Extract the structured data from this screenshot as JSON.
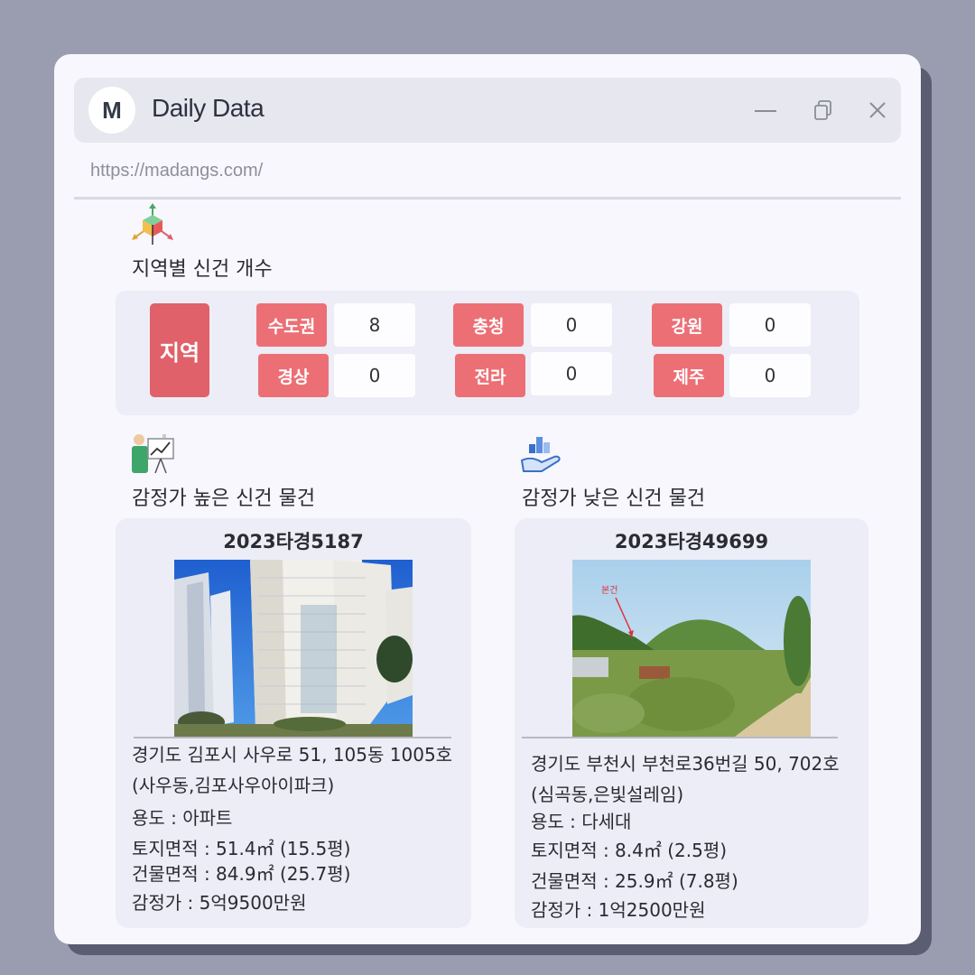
{
  "window": {
    "avatar_letter": "M",
    "title": "Daily Data",
    "url": "https://madangs.com/",
    "controls": [
      "minimize-icon",
      "copy-icon",
      "close-icon"
    ]
  },
  "region_section": {
    "title": "지역별 신건 개수",
    "icon": "cube-axes-icon",
    "main_label": "지역",
    "regions": [
      {
        "name": "수도권",
        "count": "8"
      },
      {
        "name": "충청",
        "count": "0"
      },
      {
        "name": "강원",
        "count": "0"
      },
      {
        "name": "경상",
        "count": "0"
      },
      {
        "name": "전라",
        "count": "0"
      },
      {
        "name": "제주",
        "count": "0"
      }
    ]
  },
  "high_section": {
    "title": "감정가 높은 신건 물건",
    "icon": "presentation-chart-icon",
    "case_no": "2023타경5187",
    "address_line1": "경기도 김포시 사우로 51, 105동 1005호",
    "address_line2": "(사우동,김포사우아이파크)",
    "usage": "용도 : 아파트",
    "land_area": "토지면적 : 51.4㎡ (15.5평)",
    "building_area": "건물면적 : 84.9㎡ (25.7평)",
    "appraisal": "감정가 : 5억9500만원"
  },
  "low_section": {
    "title": "감정가 낮은 신건 물건",
    "icon": "hand-bar-chart-icon",
    "case_no": "2023타경49699",
    "photo_annotation": "본건",
    "address_line1": "경기도 부천시 부천로36번길 50, 702호",
    "address_line2": "(심곡동,은빛설레임)",
    "usage": "용도 : 다세대",
    "land_area": "토지면적 : 8.4㎡ (2.5평)",
    "building_area": "건물면적 : 25.9㎡ (7.8평)",
    "appraisal": "감정가 : 1억2500만원"
  },
  "colors": {
    "background": "#9a9cb0",
    "window": "#f7f7fd",
    "panel": "#ecedf6",
    "region_label": "#ec6f75",
    "region_main": "#e0616a"
  }
}
